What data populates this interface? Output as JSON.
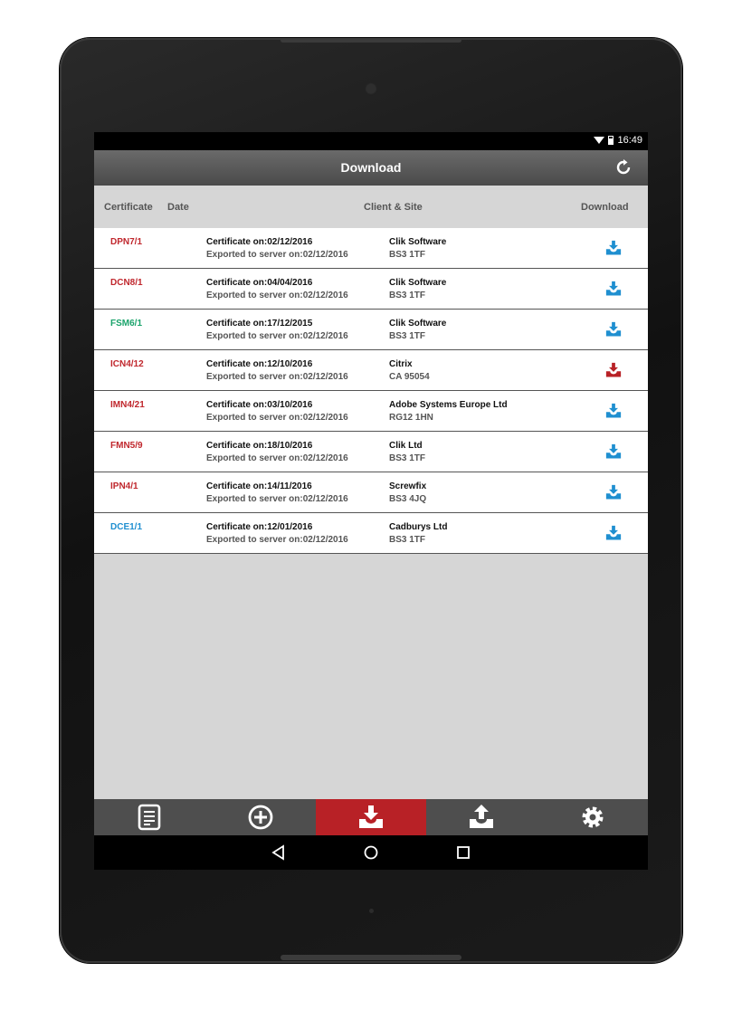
{
  "status_bar": {
    "time": "16:49"
  },
  "app_bar": {
    "title": "Download"
  },
  "columns": {
    "certificate": "Certificate",
    "date": "Date",
    "client_site": "Client & Site",
    "download": "Download"
  },
  "rows": [
    {
      "id": "DPN7/1",
      "id_color": "#c0272d",
      "cert": "Certificate on:02/12/2016",
      "exported": "Exported to server on:02/12/2016",
      "client": "Clik Software",
      "site": "BS3 1TF",
      "download_color": "#1f8fd0"
    },
    {
      "id": "DCN8/1",
      "id_color": "#c0272d",
      "cert": "Certificate on:04/04/2016",
      "exported": "Exported to server on:02/12/2016",
      "client": "Clik Software",
      "site": "BS3 1TF",
      "download_color": "#1f8fd0"
    },
    {
      "id": "FSM6/1",
      "id_color": "#1aa36b",
      "cert": "Certificate on:17/12/2015",
      "exported": "Exported to server on:02/12/2016",
      "client": "Clik Software",
      "site": "BS3 1TF",
      "download_color": "#1f8fd0"
    },
    {
      "id": "ICN4/12",
      "id_color": "#c0272d",
      "cert": "Certificate on:12/10/2016",
      "exported": "Exported to server on:02/12/2016",
      "client": "Citrix",
      "site": "CA 95054",
      "download_color": "#b82126"
    },
    {
      "id": "IMN4/21",
      "id_color": "#c0272d",
      "cert": "Certificate on:03/10/2016",
      "exported": "Exported to server on:02/12/2016",
      "client": "Adobe Systems Europe Ltd",
      "site": "RG12 1HN",
      "download_color": "#1f8fd0"
    },
    {
      "id": "FMN5/9",
      "id_color": "#c0272d",
      "cert": "Certificate on:18/10/2016",
      "exported": "Exported to server on:02/12/2016",
      "client": "Clik Ltd",
      "site": "BS3 1TF",
      "download_color": "#1f8fd0"
    },
    {
      "id": "IPN4/1",
      "id_color": "#c0272d",
      "cert": "Certificate on:14/11/2016",
      "exported": "Exported to server on:02/12/2016",
      "client": "Screwfix",
      "site": "BS3 4JQ",
      "download_color": "#1f8fd0"
    },
    {
      "id": "DCE1/1",
      "id_color": "#1f8fd0",
      "cert": "Certificate on:12/01/2016",
      "exported": "Exported to server on:02/12/2016",
      "client": "Cadburys Ltd",
      "site": "BS3 1TF",
      "download_color": "#1f8fd0"
    }
  ],
  "bottom_nav": [
    {
      "icon": "document-list-icon",
      "active": false
    },
    {
      "icon": "add-circle-icon",
      "active": false
    },
    {
      "icon": "download-tray-icon",
      "active": true
    },
    {
      "icon": "upload-tray-icon",
      "active": false
    },
    {
      "icon": "gear-icon",
      "active": false
    }
  ],
  "colors": {
    "accent": "#b82126",
    "link_blue": "#1f8fd0",
    "nav_bg": "#4e4e4e"
  }
}
